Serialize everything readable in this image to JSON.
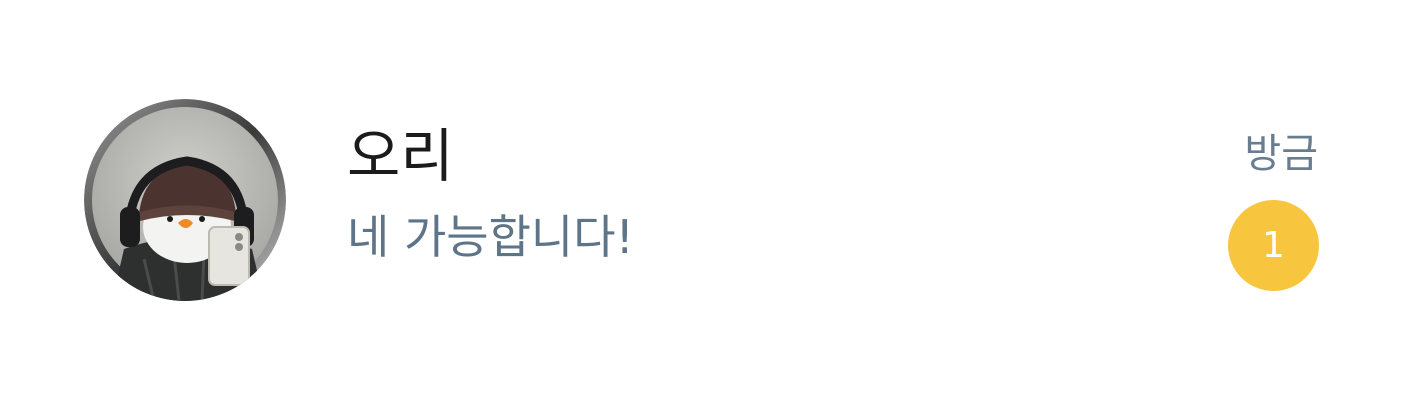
{
  "chat": {
    "name": "오리",
    "last_message": "네 가능합니다!",
    "time": "방금",
    "unread_count": "1",
    "badge_color": "#F8C53F",
    "avatar_icon": "profile-photo-avatar"
  }
}
